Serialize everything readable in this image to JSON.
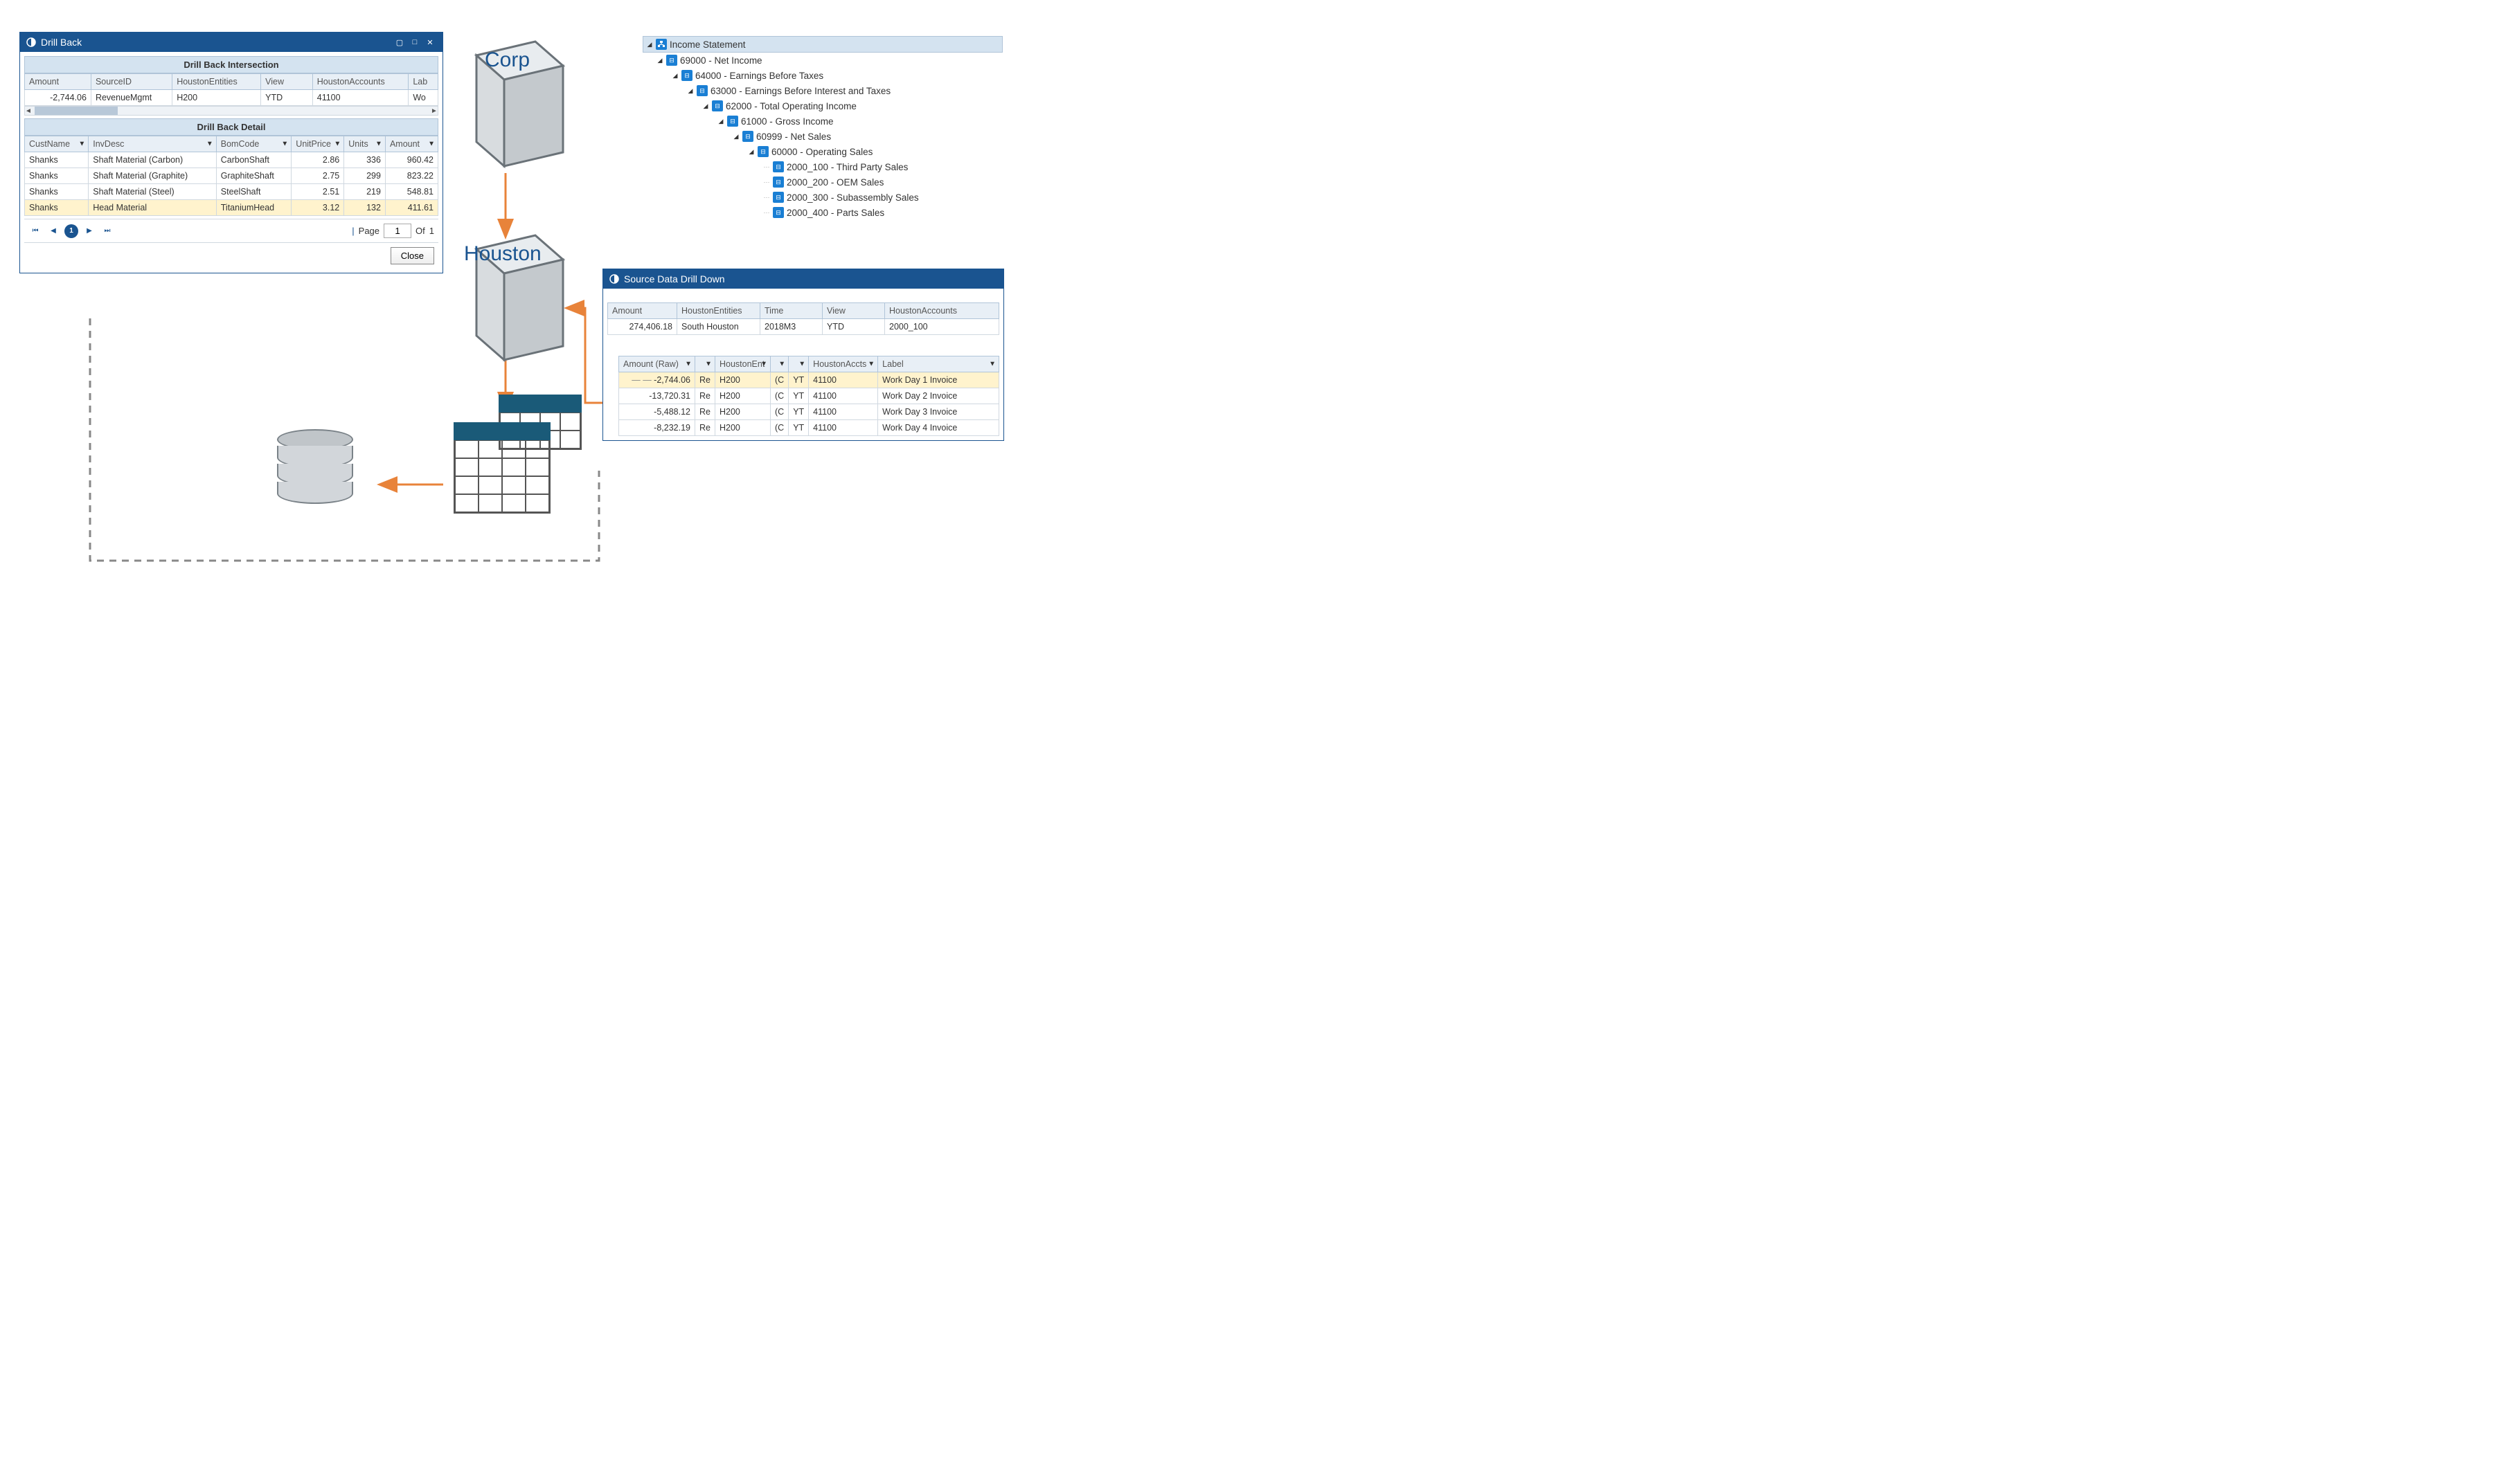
{
  "drill_back": {
    "title": "Drill Back",
    "intersection_header": "Drill Back Intersection",
    "intersection_cols": [
      "Amount",
      "SourceID",
      "HoustonEntities",
      "View",
      "HoustonAccounts",
      "Lab"
    ],
    "intersection_row": {
      "amount": "-2,744.06",
      "sourceid": "RevenueMgmt",
      "ent": "H200",
      "view": "YTD",
      "acct": "41100",
      "lab": "Wo"
    },
    "detail_header": "Drill Back Detail",
    "detail_cols": [
      "CustName",
      "InvDesc",
      "BomCode",
      "UnitPrice",
      "Units",
      "Amount"
    ],
    "detail_rows": [
      {
        "cust": "Shanks",
        "inv": "Shaft Material (Carbon)",
        "bom": "CarbonShaft",
        "price": "2.86",
        "units": "336",
        "amt": "960.42",
        "hl": false
      },
      {
        "cust": "Shanks",
        "inv": "Shaft Material (Graphite)",
        "bom": "GraphiteShaft",
        "price": "2.75",
        "units": "299",
        "amt": "823.22",
        "hl": false
      },
      {
        "cust": "Shanks",
        "inv": "Shaft Material (Steel)",
        "bom": "SteelShaft",
        "price": "2.51",
        "units": "219",
        "amt": "548.81",
        "hl": false
      },
      {
        "cust": "Shanks",
        "inv": "Head Material",
        "bom": "TitaniumHead",
        "price": "3.12",
        "units": "132",
        "amt": "411.61",
        "hl": true
      }
    ],
    "pager": {
      "page_label": "Page",
      "page": "1",
      "of_label": "Of",
      "total": "1",
      "active": "1"
    },
    "close_label": "Close"
  },
  "cubes": {
    "corp": "Corp",
    "houston": "Houston"
  },
  "tree": {
    "root": "Income Statement",
    "items": [
      {
        "indent": 0,
        "label": "69000 - Net Income"
      },
      {
        "indent": 1,
        "label": "64000 - Earnings Before Taxes"
      },
      {
        "indent": 2,
        "label": "63000 - Earnings Before Interest and Taxes"
      },
      {
        "indent": 3,
        "label": "62000 - Total Operating Income"
      },
      {
        "indent": 4,
        "label": "61000 - Gross Income"
      },
      {
        "indent": 5,
        "label": "60999 - Net Sales"
      },
      {
        "indent": 6,
        "label": "60000 - Operating Sales"
      },
      {
        "indent": 7,
        "label": "2000_100 - Third Party Sales",
        "leaf": true
      },
      {
        "indent": 7,
        "label": "2000_200 - OEM Sales",
        "leaf": true
      },
      {
        "indent": 7,
        "label": "2000_300 - Subassembly Sales",
        "leaf": true
      },
      {
        "indent": 7,
        "label": "2000_400 - Parts Sales",
        "leaf": true
      }
    ]
  },
  "drill_down": {
    "title": "Source Data Drill Down",
    "summary_cols": [
      "Amount",
      "HoustonEntities",
      "Time",
      "View",
      "HoustonAccounts"
    ],
    "summary_row": {
      "amount": "274,406.18",
      "ent": "South Houston",
      "time": "2018M3",
      "view": "YTD",
      "acct": "2000_100"
    },
    "detail_cols": [
      "Amount (Raw)",
      "",
      "HoustonEnt",
      "",
      "",
      "HoustonAccts",
      "Label"
    ],
    "detail_rows": [
      {
        "amt": "-2,744.06",
        "c1": "Re",
        "ent": "H200",
        "c2": "(C",
        "c3": "YT",
        "acct": "41100",
        "label": "Work Day 1 Invoice",
        "hl": true
      },
      {
        "amt": "-13,720.31",
        "c1": "Re",
        "ent": "H200",
        "c2": "(C",
        "c3": "YT",
        "acct": "41100",
        "label": "Work Day 2 Invoice",
        "hl": false
      },
      {
        "amt": "-5,488.12",
        "c1": "Re",
        "ent": "H200",
        "c2": "(C",
        "c3": "YT",
        "acct": "41100",
        "label": "Work Day 3 Invoice",
        "hl": false
      },
      {
        "amt": "-8,232.19",
        "c1": "Re",
        "ent": "H200",
        "c2": "(C",
        "c3": "YT",
        "acct": "41100",
        "label": "Work Day 4 Invoice",
        "hl": false
      }
    ]
  }
}
